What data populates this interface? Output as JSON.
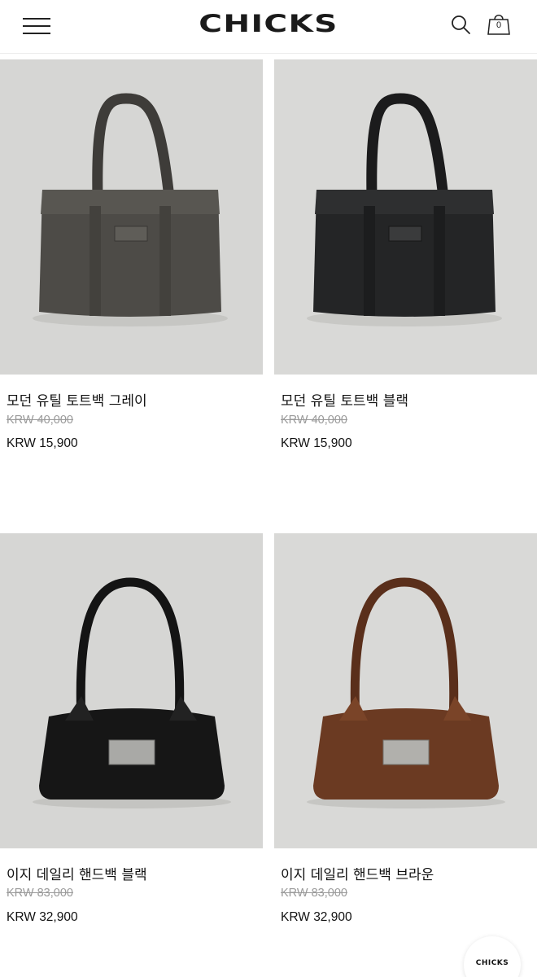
{
  "header": {
    "brand": "CHICKS",
    "cart_count": "0"
  },
  "products": [
    {
      "name": "모던 유틸 토트백 그레이",
      "original_price": "KRW 40,000",
      "sale_price": "KRW 15,900",
      "bag_color": "#4a4844"
    },
    {
      "name": "모던 유틸 토트백 블랙",
      "original_price": "KRW 40,000",
      "sale_price": "KRW 15,900",
      "bag_color": "#232425"
    },
    {
      "name": "이지 데일리 핸드백 블랙",
      "original_price": "KRW 83,000",
      "sale_price": "KRW 32,900",
      "bag_color": "#141414"
    },
    {
      "name": "이지 데일리 핸드백 브라운",
      "original_price": "KRW 83,000",
      "sale_price": "KRW 32,900",
      "bag_color": "#6b3a22"
    }
  ],
  "floating_badge": "CHICKS"
}
